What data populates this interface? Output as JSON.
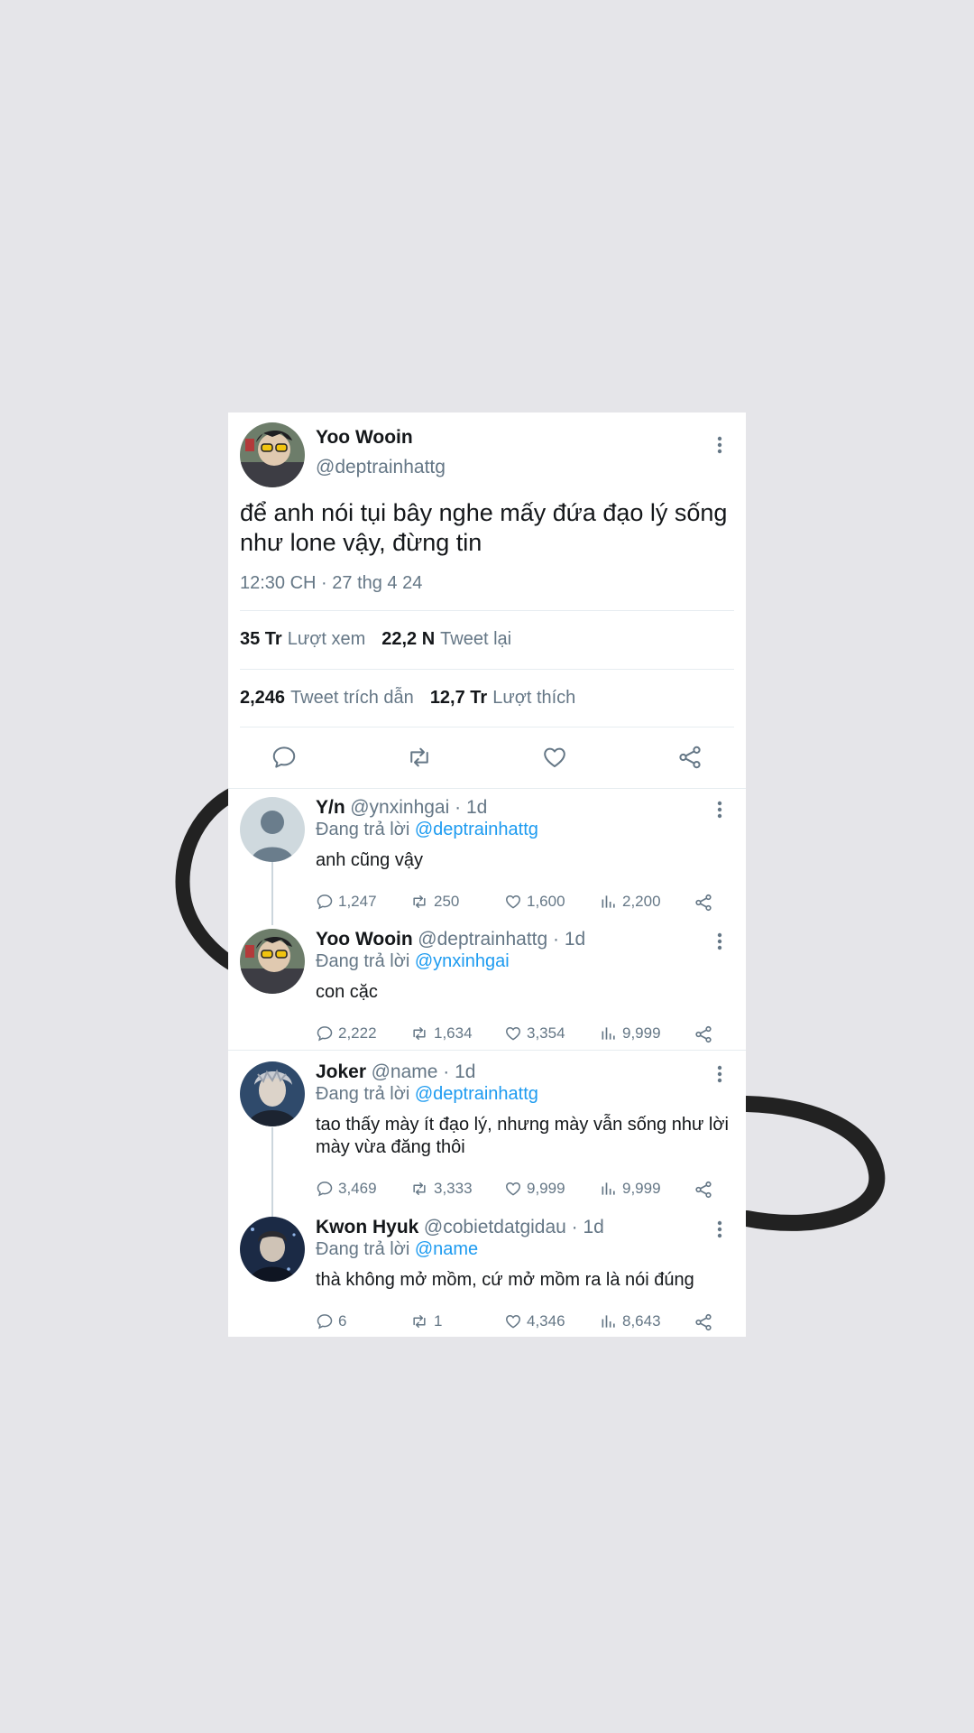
{
  "tweet": {
    "author_name": "Yoo Wooin",
    "author_handle": "@deptrainhattg",
    "text": "để anh nói tụi bây nghe mấy đứa đạo lý sống như lone vậy, đừng tin",
    "timestamp": "12:30 CH · 27 thg 4 24",
    "stats": {
      "views_count": "35 Tr",
      "views_label": "Lượt xem",
      "retweets_count": "22,2 N",
      "retweets_label": "Tweet lại",
      "quotes_count": "2,246",
      "quotes_label": "Tweet trích dẫn",
      "likes_count": "12,7 Tr",
      "likes_label": "Lượt thích"
    }
  },
  "replies": [
    {
      "name": "Y/n",
      "handle": "@ynxinhgai · 1d",
      "replying_prefix": "Đang trả lời",
      "replying_to": "@deptrainhattg",
      "text": "anh cũng vậy",
      "comments": "1,247",
      "retweets": "250",
      "likes": "1,600",
      "views": "2,200"
    },
    {
      "name": "Yoo Wooin",
      "handle": "@deptrainhattg · 1d",
      "replying_prefix": "Đang trả lời",
      "replying_to": "@ynxinhgai",
      "text": "con cặc",
      "comments": "2,222",
      "retweets": "1,634",
      "likes": "3,354",
      "views": "9,999"
    },
    {
      "name": "Joker",
      "handle": "@name · 1d",
      "replying_prefix": "Đang trả lời",
      "replying_to": "@deptrainhattg",
      "text": "tao thấy mày ít đạo lý, nhưng mày vẫn sống như lời mày vừa đăng thôi",
      "comments": "3,469",
      "retweets": "3,333",
      "likes": "9,999",
      "views": "9,999"
    },
    {
      "name": "Kwon Hyuk",
      "handle": "@cobietdatgidau · 1d",
      "replying_prefix": "Đang trả lời",
      "replying_to": "@name",
      "text": "thà không mở mồm, cứ mở mồm ra là nói đúng",
      "comments": "6",
      "retweets": "1",
      "likes": "4,346",
      "views": "8,643"
    }
  ],
  "colors": {
    "background": "#e5e5e9",
    "card": "#ffffff",
    "text": "#14171a",
    "secondary": "#657786",
    "mention": "#1d9bf0"
  },
  "icons": [
    "more-vertical-icon",
    "comment-icon",
    "retweet-icon",
    "heart-icon",
    "share-icon",
    "views-icon",
    "avatar-placeholder-icon"
  ]
}
